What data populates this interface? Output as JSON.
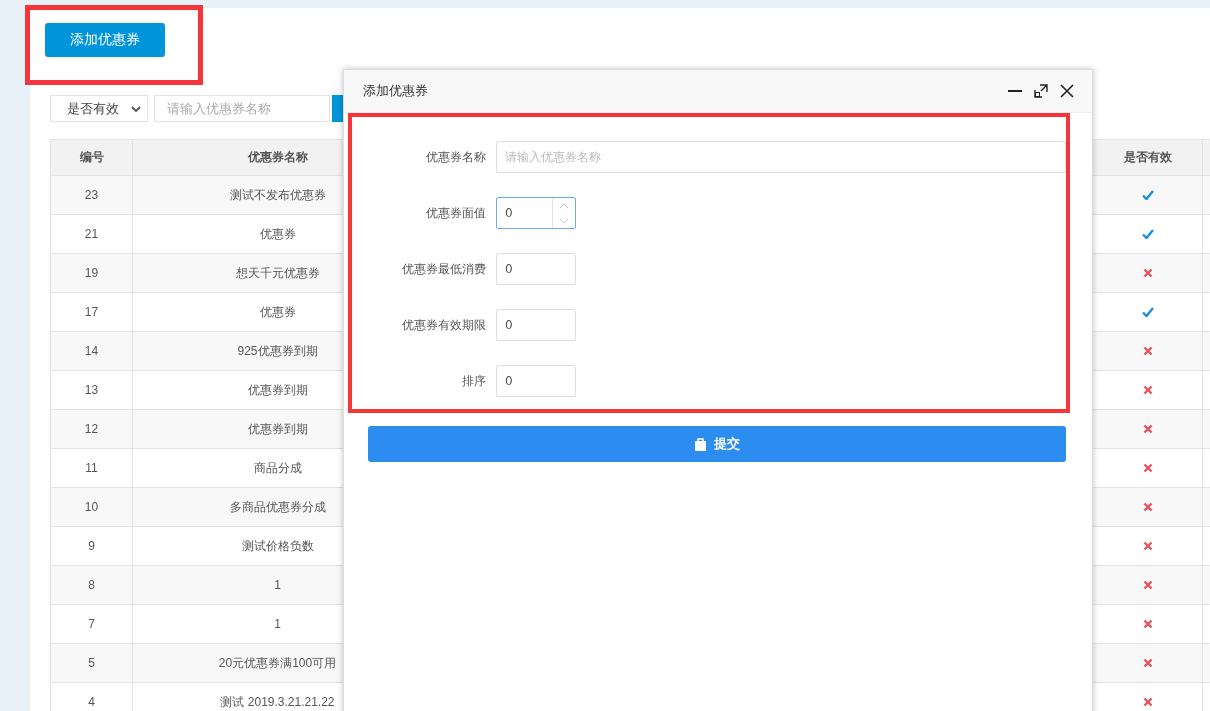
{
  "add_button": {
    "label": "添加优惠券",
    "annotated": true
  },
  "filter": {
    "select": "是否有效",
    "search_placeholder": "请输入优惠券名称"
  },
  "table": {
    "columns": [
      "编号",
      "优惠券名称",
      "是否有效"
    ],
    "rows": [
      {
        "id": "23",
        "name": "测试不发布优惠券",
        "valid": true
      },
      {
        "id": "21",
        "name": "优惠券",
        "valid": true
      },
      {
        "id": "19",
        "name": "想天千元优惠券",
        "valid": false
      },
      {
        "id": "17",
        "name": "优惠券",
        "valid": true
      },
      {
        "id": "14",
        "name": "925优惠券到期",
        "valid": false
      },
      {
        "id": "13",
        "name": "优惠券到期",
        "valid": false
      },
      {
        "id": "12",
        "name": "优惠券到期",
        "valid": false
      },
      {
        "id": "11",
        "name": "商品分成",
        "valid": false
      },
      {
        "id": "10",
        "name": "多商品优惠券分成",
        "valid": false
      },
      {
        "id": "9",
        "name": "测试价格负数",
        "valid": false
      },
      {
        "id": "8",
        "name": "1",
        "valid": false
      },
      {
        "id": "7",
        "name": "1",
        "valid": false
      },
      {
        "id": "5",
        "name": "20元优惠券满100可用",
        "valid": false
      },
      {
        "id": "4",
        "name": "测试 2019.3.21.21.22",
        "valid": false
      }
    ]
  },
  "dialog": {
    "title": "添加优惠券",
    "annotated": true,
    "fields": [
      {
        "label": "优惠券名称",
        "kind": "text",
        "placeholder": "请输入优惠券名称",
        "focused": false
      },
      {
        "label": "优惠券面值",
        "kind": "spinner",
        "value": "0",
        "focused": true
      },
      {
        "label": "优惠券最低消费",
        "kind": "number",
        "value": "0",
        "focused": false
      },
      {
        "label": "优惠券有效期限",
        "kind": "number",
        "value": "0",
        "focused": false
      },
      {
        "label": "排序",
        "kind": "number",
        "value": "0",
        "focused": false
      }
    ],
    "submit": "提交"
  }
}
